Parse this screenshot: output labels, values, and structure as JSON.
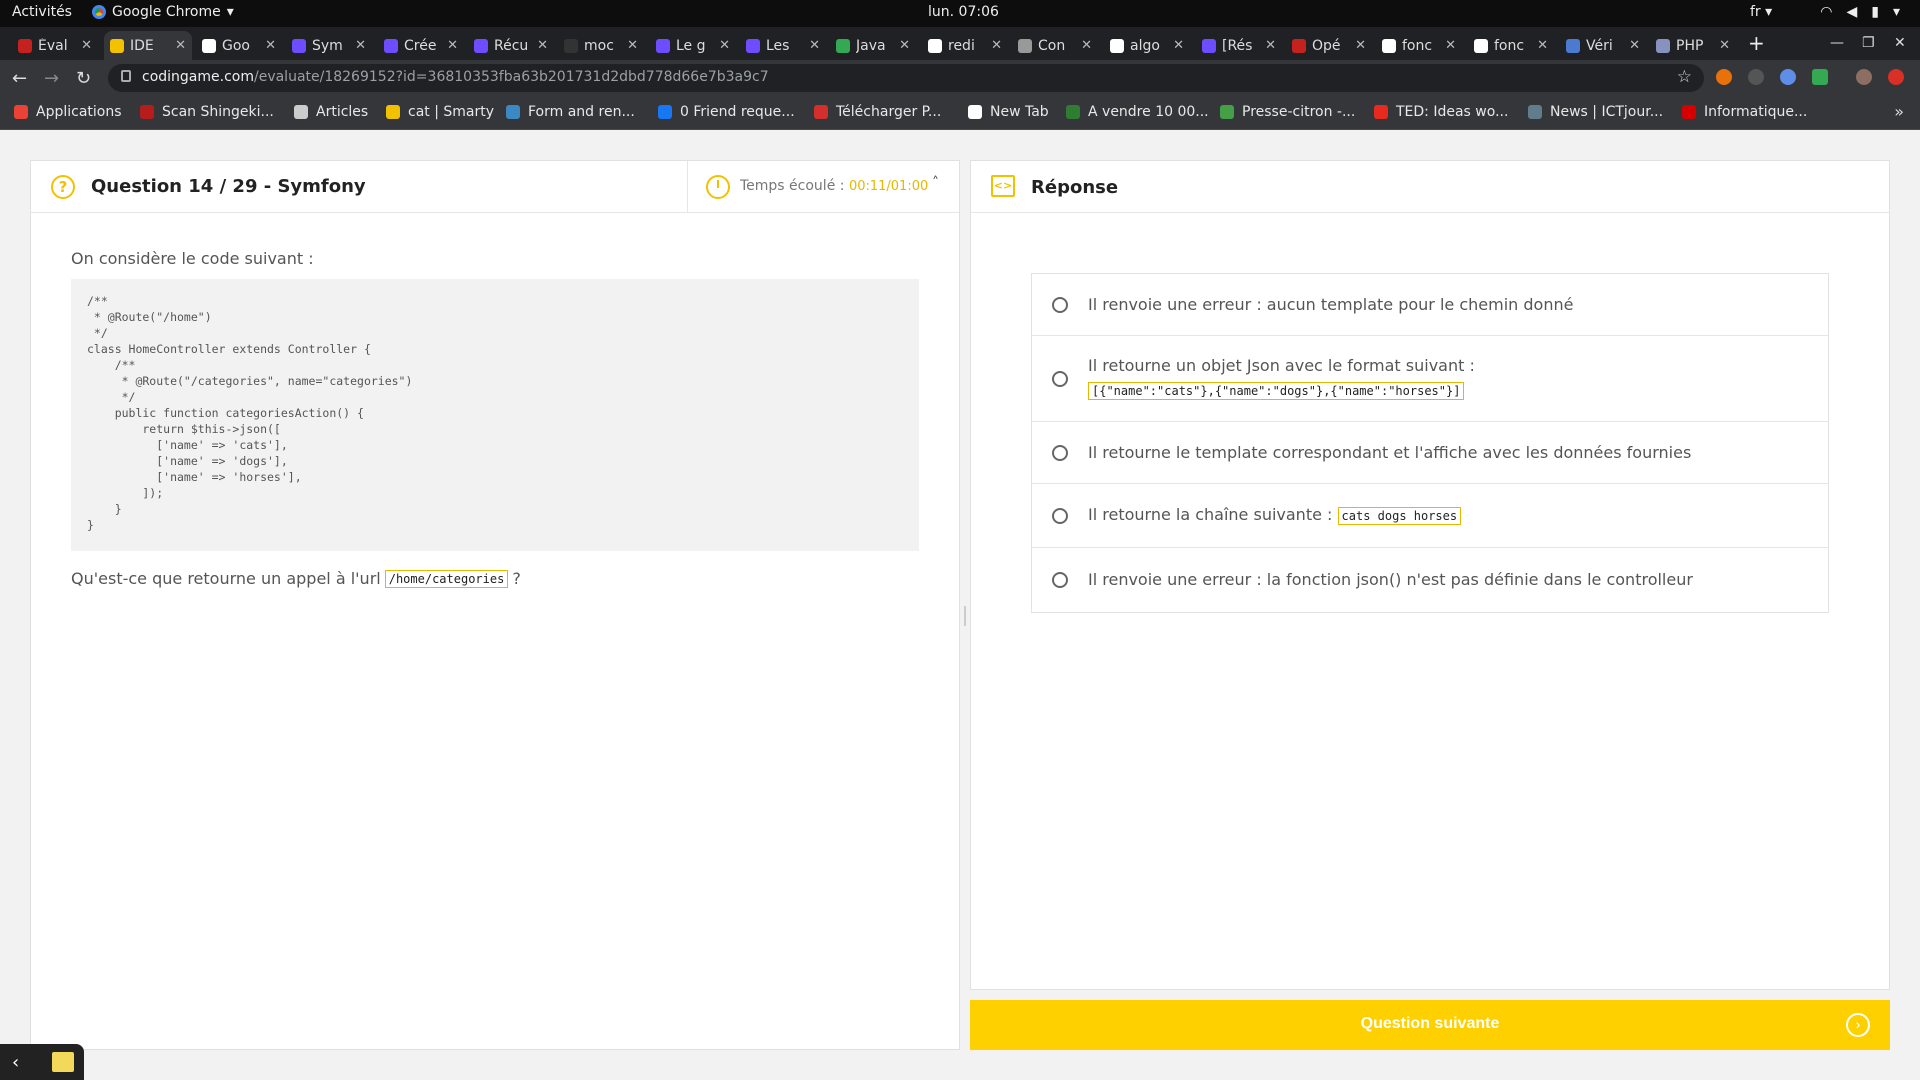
{
  "topbar": {
    "activities": "Activités",
    "app_name": "Google Chrome",
    "clock": "lun. 07:06",
    "lang": "fr"
  },
  "tabs": [
    {
      "label": "Éval",
      "color": "#c5221f"
    },
    {
      "label": "IDE",
      "color": "#f2c200",
      "active": true
    },
    {
      "label": "Goo",
      "color": "#ffffff"
    },
    {
      "label": "Sym",
      "color": "#6e4cff"
    },
    {
      "label": "Crée",
      "color": "#6e4cff"
    },
    {
      "label": "Récu",
      "color": "#6e4cff"
    },
    {
      "label": "moc",
      "color": "#333333"
    },
    {
      "label": "Le g",
      "color": "#6e4cff"
    },
    {
      "label": "Les",
      "color": "#6e4cff"
    },
    {
      "label": "Java",
      "color": "#34a853"
    },
    {
      "label": "redi",
      "color": "#ffffff"
    },
    {
      "label": "Con",
      "color": "#999999"
    },
    {
      "label": "algo",
      "color": "#ffffff"
    },
    {
      "label": "[Rés",
      "color": "#6e4cff"
    },
    {
      "label": "Opé",
      "color": "#c5221f"
    },
    {
      "label": "fonc",
      "color": "#ffffff"
    },
    {
      "label": "fonc",
      "color": "#ffffff"
    },
    {
      "label": "Véri",
      "color": "#4a7bd1"
    },
    {
      "label": "PHP",
      "color": "#8892bf"
    }
  ],
  "address": {
    "host": "codingame.com",
    "path": "/evaluate/18269152?id=36810353fba63b201731d2dbd778d66e7b3a9c7"
  },
  "bookmarks": [
    {
      "label": "Applications",
      "color": "#ea4335"
    },
    {
      "label": "Scan Shingeki...",
      "color": "#b71c1c"
    },
    {
      "label": "Articles",
      "color": "#cccccc"
    },
    {
      "label": "cat | Smarty",
      "color": "#f2c200"
    },
    {
      "label": "Form and ren...",
      "color": "#3b88c3"
    },
    {
      "label": "0 Friend reque...",
      "color": "#1877f2"
    },
    {
      "label": "Télécharger P...",
      "color": "#d32f2f"
    },
    {
      "label": "New Tab",
      "color": "#ffffff"
    },
    {
      "label": "A vendre 10 00...",
      "color": "#2e7d32"
    },
    {
      "label": "Presse-citron -...",
      "color": "#43a047"
    },
    {
      "label": "TED: Ideas wo...",
      "color": "#e62b1e"
    },
    {
      "label": "News | ICTjour...",
      "color": "#607d8b"
    },
    {
      "label": "Informatique...",
      "color": "#d50000"
    }
  ],
  "question": {
    "title": "Question 14 / 29 - Symfony",
    "timer_label": "Temps écoulé : ",
    "timer_value": "00:11/01:00",
    "intro": "On considère le code suivant :",
    "prompt_before": "Qu'est-ce que retourne un appel à l'url",
    "prompt_code": "/home/categories",
    "prompt_after": "?"
  },
  "code_lines": [
    "/**",
    " * @Route(\"/home\")",
    " */",
    "class HomeController extends Controller {",
    "    /**",
    "     * @Route(\"/categories\", name=\"categories\")",
    "     */",
    "    public function categoriesAction() {",
    "        return $this->json([",
    "          ['name' => 'cats'],",
    "          ['name' => 'dogs'],",
    "          ['name' => 'horses'],",
    "        ]);",
    "    }",
    "}"
  ],
  "response": {
    "title": "Réponse",
    "answers": [
      {
        "text": "Il renvoie une erreur : aucun template pour le chemin donné"
      },
      {
        "text": "Il retourne un objet Json avec le format suivant :",
        "code": "[{\"name\":\"cats\"},{\"name\":\"dogs\"},{\"name\":\"horses\"}]"
      },
      {
        "text": "Il retourne le template correspondant et l'affiche avec les données fournies"
      },
      {
        "text": "Il retourne la chaîne suivante :",
        "code": "cats dogs horses"
      },
      {
        "text": "Il renvoie une erreur : la fonction json() n'est pas définie dans le controlleur"
      }
    ],
    "next_label": "Question suivante"
  },
  "colors": {
    "accent": "#ffd000",
    "timer": "#e8b800"
  },
  "icons": {
    "question": "?",
    "response": "<>"
  }
}
